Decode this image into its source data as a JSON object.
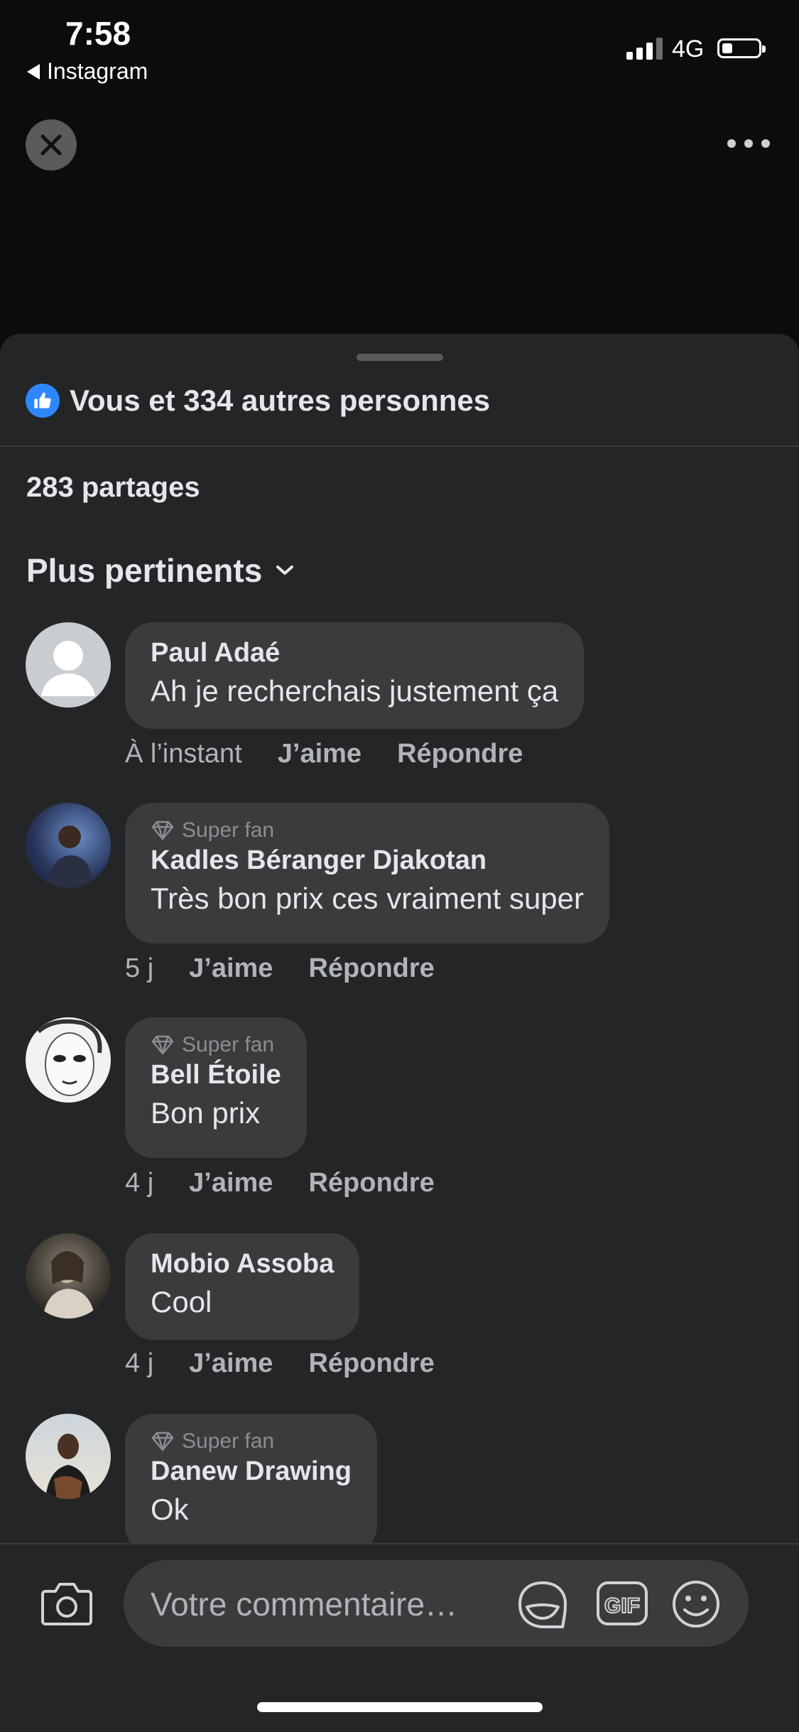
{
  "status_bar": {
    "time": "7:58",
    "back_app": "Instagram",
    "network": "4G"
  },
  "sheet": {
    "likes_text": "Vous et 334 autres personnes",
    "shares_text": "283 partages",
    "sort_label": "Plus pertinents"
  },
  "comments": [
    {
      "badge": "",
      "author": "Paul Adaé",
      "text": "Ah je recherchais justement ça",
      "time": "À l’instant",
      "like": "J’aime",
      "reply": "Répondre"
    },
    {
      "badge": "Super fan",
      "author": "Kadles Béranger Djakotan",
      "text": "Très bon prix ces vraiment super",
      "time": "5 j",
      "like": "J’aime",
      "reply": "Répondre"
    },
    {
      "badge": "Super fan",
      "author": "Bell Étoile",
      "text": "Bon prix",
      "time": "4 j",
      "like": "J’aime",
      "reply": "Répondre"
    },
    {
      "badge": "",
      "author": "Mobio Assoba",
      "text": "Cool",
      "time": "4 j",
      "like": "J’aime",
      "reply": "Répondre"
    },
    {
      "badge": "Super fan",
      "author": "Danew Drawing",
      "text": "Ok",
      "time": "",
      "like": "",
      "reply": ""
    }
  ],
  "composer": {
    "placeholder": "Votre commentaire…",
    "gif_label": "GIF"
  },
  "colors": {
    "background": "#0c0c0d",
    "sheet": "#242526",
    "bubble": "#3a3b3c",
    "like_blue": "#2d88ff"
  }
}
